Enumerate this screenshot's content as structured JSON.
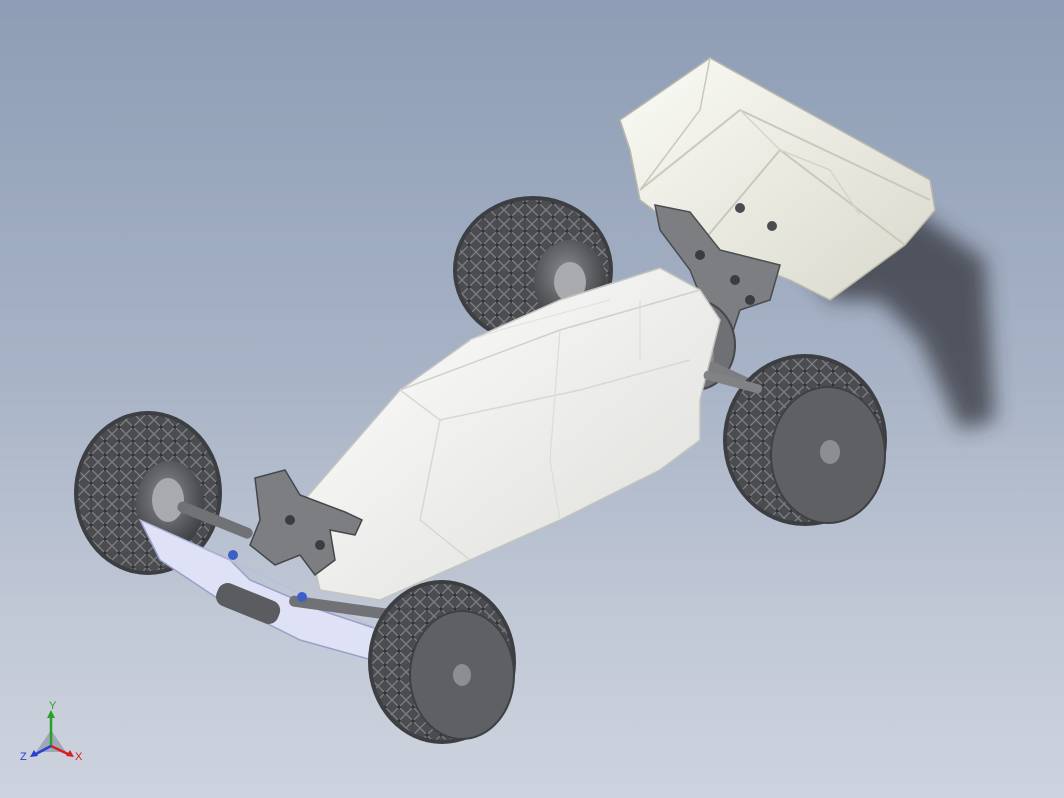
{
  "viewport": {
    "background_top": "#8e9db5",
    "background_bottom": "#cdd3de",
    "model": {
      "body_color": "#f4f4f2",
      "wing_color": "#eeeee6",
      "tire_color": "#55575a",
      "wheel_color": "#5e6064",
      "suspension_color": "#707274",
      "arm_color": "#dde1f4",
      "accent_blue": "#3d5fc8"
    }
  },
  "triad": {
    "x_label": "X",
    "y_label": "Y",
    "z_label": "Z",
    "x_color": "#d62020",
    "y_color": "#28a028",
    "z_color": "#2a3fd0"
  }
}
